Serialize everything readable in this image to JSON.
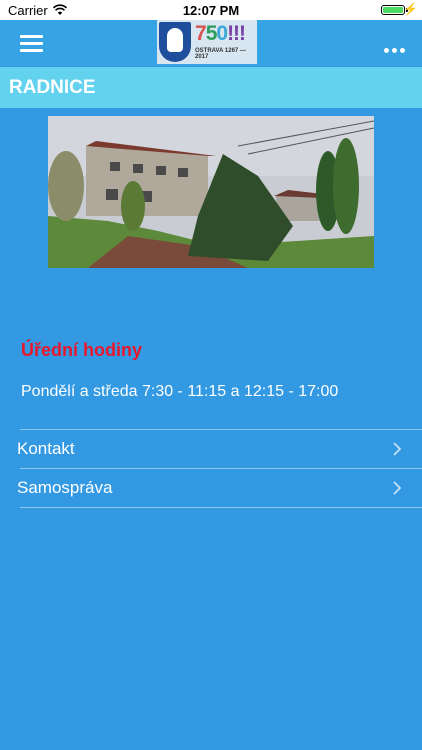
{
  "status_bar": {
    "carrier": "Carrier",
    "time": "12:07 PM",
    "wifi_icon": "wifi-icon",
    "battery_icon": "battery-icon",
    "charging_icon": "charging-bolt-icon"
  },
  "navbar": {
    "menu_icon": "hamburger-menu-icon",
    "more_icon": "more-dots-icon",
    "logo": {
      "digits": [
        "7",
        "5",
        "0",
        "!!!"
      ],
      "subtitle": "OSTRAVA 1267 — 2017"
    }
  },
  "page": {
    "title": "RADNICE"
  },
  "hours": {
    "heading": "Úřední hodiny",
    "text": "Pondělí a středa 7:30 - 11:15 a 12:15 - 17:00"
  },
  "list": [
    {
      "label": "Kontakt"
    },
    {
      "label": "Samospráva"
    }
  ],
  "colors": {
    "background": "#3399e3",
    "navbar": "#35a3e4",
    "titlebar": "#63d2ef",
    "heading_red": "#e8172b"
  }
}
